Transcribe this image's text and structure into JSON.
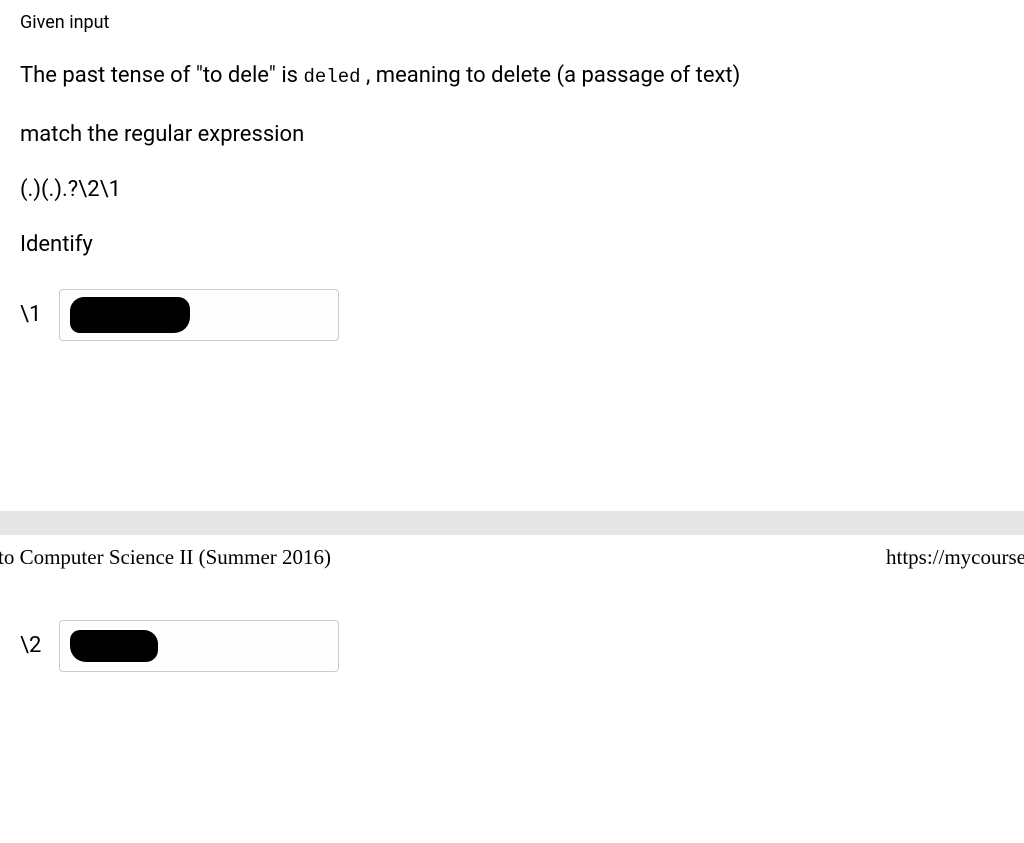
{
  "header": {
    "given_input": "Given input"
  },
  "sentence": {
    "prefix": "The past tense of \"to dele\" is",
    "code_word": "deled",
    "suffix": ", meaning to delete (a passage of text)"
  },
  "match_line": "match the regular expression",
  "regex": "(.)(.).?\\2\\1",
  "identify": "Identify",
  "answers": {
    "label1": "\\1",
    "label2": "\\2"
  },
  "footer": {
    "left": "to Computer Science II (Summer 2016)",
    "right": "https://mycourse"
  }
}
